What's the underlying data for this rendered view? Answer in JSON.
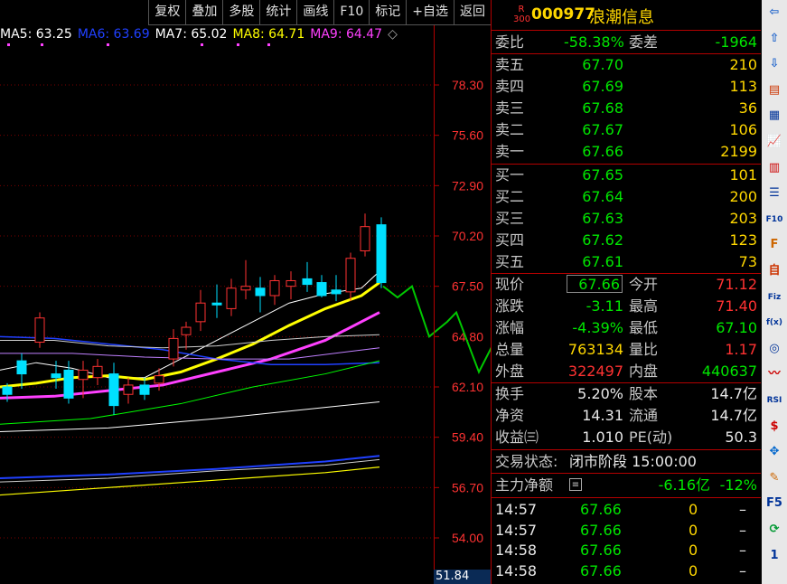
{
  "toolbar": {
    "buttons": [
      "复权",
      "叠加",
      "多股",
      "统计",
      "画线",
      "F10",
      "标记",
      "+自选",
      "返回"
    ]
  },
  "ma_legend": [
    {
      "label": "MA5: 63.25",
      "color": "#ffffff"
    },
    {
      "label": "MA6: 63.69",
      "color": "#2040ff"
    },
    {
      "label": "MA7: 65.02",
      "color": "#ffffff"
    },
    {
      "label": "MA8: 64.71",
      "color": "#ffff00"
    },
    {
      "label": "MA9: 64.47",
      "color": "#ff40ff"
    }
  ],
  "ma_legend_icon": "diamond-icon",
  "price_axis": {
    "ticks": [
      "78.30",
      "75.60",
      "72.90",
      "70.20",
      "67.50",
      "64.80",
      "62.10",
      "59.40",
      "56.70",
      "54.00"
    ],
    "bottom_value": "51.84",
    "color": "#ff3232"
  },
  "stock": {
    "badge_top": "R",
    "badge_bottom": "300",
    "code": "000977",
    "name": "浪潮信息"
  },
  "order_book": {
    "weibi_label": "委比",
    "weibi_value": "-58.38%",
    "weicha_label": "委差",
    "weicha_value": "-1964",
    "asks": [
      {
        "label": "卖五",
        "price": "67.70",
        "vol": "210"
      },
      {
        "label": "卖四",
        "price": "67.69",
        "vol": "113"
      },
      {
        "label": "卖三",
        "price": "67.68",
        "vol": "36"
      },
      {
        "label": "卖二",
        "price": "67.67",
        "vol": "106"
      },
      {
        "label": "卖一",
        "price": "67.66",
        "vol": "2199"
      }
    ],
    "bids": [
      {
        "label": "买一",
        "price": "67.65",
        "vol": "101"
      },
      {
        "label": "买二",
        "price": "67.64",
        "vol": "200"
      },
      {
        "label": "买三",
        "price": "67.63",
        "vol": "203"
      },
      {
        "label": "买四",
        "price": "67.62",
        "vol": "123"
      },
      {
        "label": "买五",
        "price": "67.61",
        "vol": "73"
      }
    ]
  },
  "quote": {
    "xianjia_label": "现价",
    "xianjia": "67.66",
    "jinkai_label": "今开",
    "jinkai": "71.12",
    "zhangdie_label": "涨跌",
    "zhangdie": "-3.11",
    "zuigao_label": "最高",
    "zuigao": "71.40",
    "zhangfu_label": "涨幅",
    "zhangfu": "-4.39%",
    "zuidi_label": "最低",
    "zuidi": "67.10",
    "zongliang_label": "总量",
    "zongliang": "763134",
    "liangbi_label": "量比",
    "liangbi": "1.17",
    "waipan_label": "外盘",
    "waipan": "322497",
    "neipan_label": "内盘",
    "neipan": "440637",
    "huanshou_label": "换手",
    "huanshou": "5.20%",
    "guben_label": "股本",
    "guben": "14.7亿",
    "jingzi_label": "净资",
    "jingzi": "14.31",
    "liutong_label": "流通",
    "liutong": "14.7亿",
    "shouyi_label": "收益㈢",
    "shouyi": "1.010",
    "pe_label": "PE(动)",
    "pe": "50.3"
  },
  "status": {
    "label": "交易状态:",
    "value": "闭市阶段 15:00:00"
  },
  "main_flow": {
    "label": "主力净额",
    "value": "-6.16亿",
    "pct": "-12%"
  },
  "ticks": [
    {
      "time": "14:57",
      "price": "67.66",
      "vol": "0",
      "flag": "–"
    },
    {
      "time": "14:57",
      "price": "67.66",
      "vol": "0",
      "flag": "–"
    },
    {
      "time": "14:58",
      "price": "67.66",
      "vol": "0",
      "flag": "–"
    },
    {
      "time": "14:58",
      "price": "67.66",
      "vol": "0",
      "flag": "–"
    }
  ],
  "sidebar_icons": [
    {
      "name": "arrow-left-icon",
      "glyph": "⇦"
    },
    {
      "name": "arrow-up-icon",
      "glyph": "⇧"
    },
    {
      "name": "arrow-down-icon",
      "glyph": "⇩"
    },
    {
      "name": "report-icon",
      "glyph": "▤"
    },
    {
      "name": "grid-icon",
      "glyph": "▦"
    },
    {
      "name": "line-chart-icon",
      "glyph": "📈"
    },
    {
      "name": "candle-chart-icon",
      "glyph": "▥"
    },
    {
      "name": "list-icon",
      "glyph": "☰"
    },
    {
      "name": "f10-icon",
      "glyph": "F10"
    },
    {
      "name": "f-icon",
      "glyph": "F"
    },
    {
      "name": "self-icon",
      "glyph": "自"
    },
    {
      "name": "fiz-icon",
      "glyph": "Fiz"
    },
    {
      "name": "fx-icon",
      "glyph": "f(x)"
    },
    {
      "name": "circle-icon",
      "glyph": "◎"
    },
    {
      "name": "wave-icon",
      "glyph": "〰"
    },
    {
      "name": "rsi-icon",
      "glyph": "RSI"
    },
    {
      "name": "dollar-icon",
      "glyph": "$"
    },
    {
      "name": "move-icon",
      "glyph": "✥"
    },
    {
      "name": "pen-icon",
      "glyph": "✎"
    },
    {
      "name": "f5-icon",
      "glyph": "F5"
    },
    {
      "name": "refresh-icon",
      "glyph": "⟳"
    },
    {
      "name": "page-number",
      "glyph": "1"
    }
  ]
}
